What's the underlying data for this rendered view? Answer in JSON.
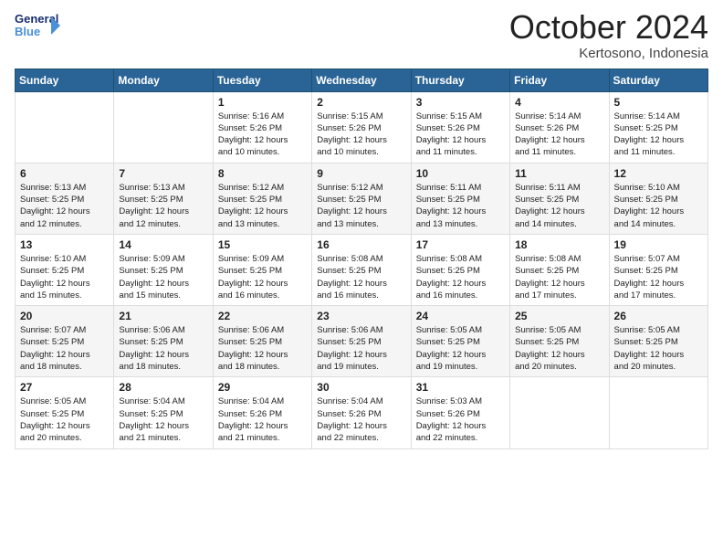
{
  "logo": {
    "text_general": "General",
    "text_blue": "Blue"
  },
  "title": "October 2024",
  "location": "Kertosono, Indonesia",
  "weekdays": [
    "Sunday",
    "Monday",
    "Tuesday",
    "Wednesday",
    "Thursday",
    "Friday",
    "Saturday"
  ],
  "weeks": [
    [
      {
        "day": "",
        "info": ""
      },
      {
        "day": "",
        "info": ""
      },
      {
        "day": "1",
        "info": "Sunrise: 5:16 AM\nSunset: 5:26 PM\nDaylight: 12 hours\nand 10 minutes."
      },
      {
        "day": "2",
        "info": "Sunrise: 5:15 AM\nSunset: 5:26 PM\nDaylight: 12 hours\nand 10 minutes."
      },
      {
        "day": "3",
        "info": "Sunrise: 5:15 AM\nSunset: 5:26 PM\nDaylight: 12 hours\nand 11 minutes."
      },
      {
        "day": "4",
        "info": "Sunrise: 5:14 AM\nSunset: 5:26 PM\nDaylight: 12 hours\nand 11 minutes."
      },
      {
        "day": "5",
        "info": "Sunrise: 5:14 AM\nSunset: 5:25 PM\nDaylight: 12 hours\nand 11 minutes."
      }
    ],
    [
      {
        "day": "6",
        "info": "Sunrise: 5:13 AM\nSunset: 5:25 PM\nDaylight: 12 hours\nand 12 minutes."
      },
      {
        "day": "7",
        "info": "Sunrise: 5:13 AM\nSunset: 5:25 PM\nDaylight: 12 hours\nand 12 minutes."
      },
      {
        "day": "8",
        "info": "Sunrise: 5:12 AM\nSunset: 5:25 PM\nDaylight: 12 hours\nand 13 minutes."
      },
      {
        "day": "9",
        "info": "Sunrise: 5:12 AM\nSunset: 5:25 PM\nDaylight: 12 hours\nand 13 minutes."
      },
      {
        "day": "10",
        "info": "Sunrise: 5:11 AM\nSunset: 5:25 PM\nDaylight: 12 hours\nand 13 minutes."
      },
      {
        "day": "11",
        "info": "Sunrise: 5:11 AM\nSunset: 5:25 PM\nDaylight: 12 hours\nand 14 minutes."
      },
      {
        "day": "12",
        "info": "Sunrise: 5:10 AM\nSunset: 5:25 PM\nDaylight: 12 hours\nand 14 minutes."
      }
    ],
    [
      {
        "day": "13",
        "info": "Sunrise: 5:10 AM\nSunset: 5:25 PM\nDaylight: 12 hours\nand 15 minutes."
      },
      {
        "day": "14",
        "info": "Sunrise: 5:09 AM\nSunset: 5:25 PM\nDaylight: 12 hours\nand 15 minutes."
      },
      {
        "day": "15",
        "info": "Sunrise: 5:09 AM\nSunset: 5:25 PM\nDaylight: 12 hours\nand 16 minutes."
      },
      {
        "day": "16",
        "info": "Sunrise: 5:08 AM\nSunset: 5:25 PM\nDaylight: 12 hours\nand 16 minutes."
      },
      {
        "day": "17",
        "info": "Sunrise: 5:08 AM\nSunset: 5:25 PM\nDaylight: 12 hours\nand 16 minutes."
      },
      {
        "day": "18",
        "info": "Sunrise: 5:08 AM\nSunset: 5:25 PM\nDaylight: 12 hours\nand 17 minutes."
      },
      {
        "day": "19",
        "info": "Sunrise: 5:07 AM\nSunset: 5:25 PM\nDaylight: 12 hours\nand 17 minutes."
      }
    ],
    [
      {
        "day": "20",
        "info": "Sunrise: 5:07 AM\nSunset: 5:25 PM\nDaylight: 12 hours\nand 18 minutes."
      },
      {
        "day": "21",
        "info": "Sunrise: 5:06 AM\nSunset: 5:25 PM\nDaylight: 12 hours\nand 18 minutes."
      },
      {
        "day": "22",
        "info": "Sunrise: 5:06 AM\nSunset: 5:25 PM\nDaylight: 12 hours\nand 18 minutes."
      },
      {
        "day": "23",
        "info": "Sunrise: 5:06 AM\nSunset: 5:25 PM\nDaylight: 12 hours\nand 19 minutes."
      },
      {
        "day": "24",
        "info": "Sunrise: 5:05 AM\nSunset: 5:25 PM\nDaylight: 12 hours\nand 19 minutes."
      },
      {
        "day": "25",
        "info": "Sunrise: 5:05 AM\nSunset: 5:25 PM\nDaylight: 12 hours\nand 20 minutes."
      },
      {
        "day": "26",
        "info": "Sunrise: 5:05 AM\nSunset: 5:25 PM\nDaylight: 12 hours\nand 20 minutes."
      }
    ],
    [
      {
        "day": "27",
        "info": "Sunrise: 5:05 AM\nSunset: 5:25 PM\nDaylight: 12 hours\nand 20 minutes."
      },
      {
        "day": "28",
        "info": "Sunrise: 5:04 AM\nSunset: 5:25 PM\nDaylight: 12 hours\nand 21 minutes."
      },
      {
        "day": "29",
        "info": "Sunrise: 5:04 AM\nSunset: 5:26 PM\nDaylight: 12 hours\nand 21 minutes."
      },
      {
        "day": "30",
        "info": "Sunrise: 5:04 AM\nSunset: 5:26 PM\nDaylight: 12 hours\nand 22 minutes."
      },
      {
        "day": "31",
        "info": "Sunrise: 5:03 AM\nSunset: 5:26 PM\nDaylight: 12 hours\nand 22 minutes."
      },
      {
        "day": "",
        "info": ""
      },
      {
        "day": "",
        "info": ""
      }
    ]
  ]
}
